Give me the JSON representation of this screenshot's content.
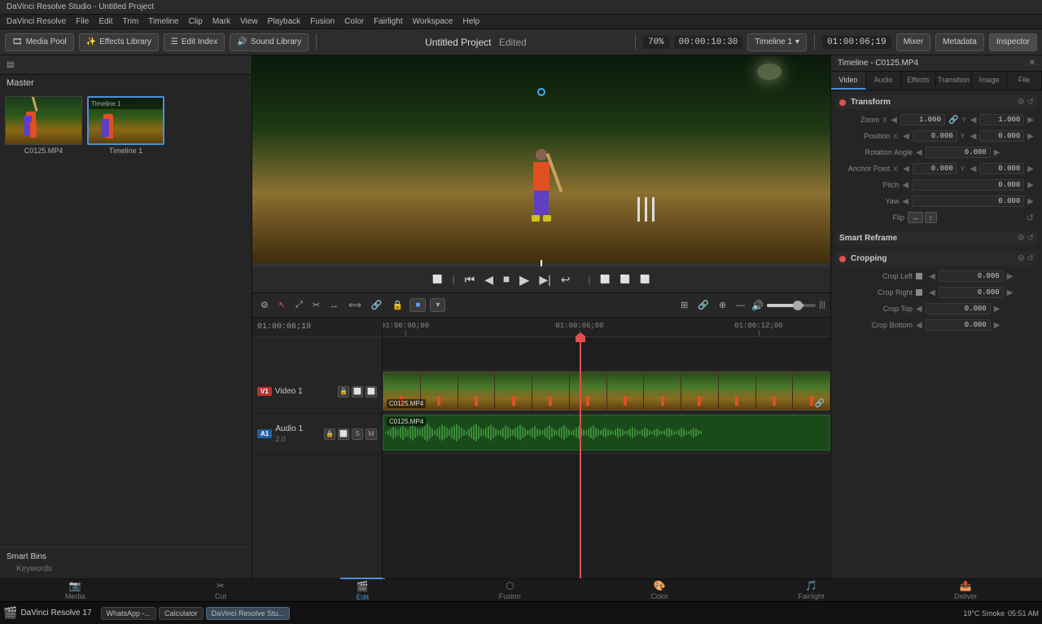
{
  "window": {
    "title": "DaVinci Resolve Studio - Untitled Project"
  },
  "menu": {
    "items": [
      "DaVinci Resolve",
      "File",
      "Edit",
      "Trim",
      "Timeline",
      "Clip",
      "Mark",
      "View",
      "Playback",
      "Fusion",
      "Color",
      "Fairlight",
      "Workspace",
      "Help"
    ]
  },
  "toolbar": {
    "media_pool": "Media Pool",
    "effects_library": "Effects Library",
    "edit_index": "Edit Index",
    "sound_library": "Sound Library",
    "project_title": "Untitled Project",
    "edited": "Edited",
    "zoom": "70%",
    "timecode": "00:00:10:30",
    "timeline_name": "Timeline 1",
    "playhead_tc": "01:00:06;19",
    "mixer": "Mixer",
    "metadata": "Metadata",
    "inspector": "Inspector"
  },
  "timeline_header": {
    "label": "Timeline - C0125.MP4"
  },
  "left_panel": {
    "master_label": "Master",
    "media_items": [
      {
        "name": "C0125.MP4",
        "type": "video"
      },
      {
        "name": "Timeline 1",
        "type": "timeline"
      }
    ],
    "smart_bins": "Smart Bins",
    "keywords": "Keywords"
  },
  "preview": {
    "timecode": "01:00:06;19"
  },
  "preview_controls": {
    "buttons": [
      "⏮",
      "◀",
      "⏹",
      "▶",
      "⏭",
      "↩"
    ]
  },
  "timeline": {
    "ruler_marks": [
      "01:00:00;00",
      "01:00:06;00",
      "01:00:12;00"
    ],
    "playhead_position": "01:00:06;19",
    "tracks": [
      {
        "type": "video",
        "badge": "V1",
        "name": "Video 1",
        "clips": [
          {
            "label": "C0125.MP4"
          }
        ]
      },
      {
        "type": "audio",
        "badge": "A1",
        "name": "Audio 1",
        "number": "2.0",
        "clips": [
          {
            "label": "C0125.MP4"
          }
        ]
      }
    ]
  },
  "inspector": {
    "title": "Timeline - C0125.MP4",
    "tabs": [
      "Video",
      "Audio",
      "Effects",
      "Transition",
      "Image",
      "File"
    ],
    "active_tab": "Video",
    "sections": {
      "transform": {
        "title": "Transform",
        "fields": {
          "zoom_x": "1.000",
          "zoom_y": "1.000",
          "position_x": "0.000",
          "position_y": "0.000",
          "rotation_angle": "0.000",
          "anchor_point_x": "0.000",
          "anchor_point_y": "0.000",
          "pitch": "0.000",
          "yaw": "0.000"
        }
      },
      "smart_reframe": {
        "title": "Smart Reframe"
      },
      "cropping": {
        "title": "Cropping",
        "fields": {
          "crop_left": "0.000",
          "crop_right": "0.000",
          "crop_top": "0.000",
          "crop_bottom": "0.000"
        }
      }
    }
  },
  "bottom_tabs": [
    {
      "label": "Media",
      "icon": "📷",
      "active": false
    },
    {
      "label": "Cut",
      "icon": "✂",
      "active": false
    },
    {
      "label": "Edit",
      "icon": "🎬",
      "active": true
    },
    {
      "label": "Fusion",
      "icon": "⬡",
      "active": false
    },
    {
      "label": "Color",
      "icon": "🎨",
      "active": false
    },
    {
      "label": "Fairlight",
      "icon": "🎵",
      "active": false
    },
    {
      "label": "Deliver",
      "icon": "📤",
      "active": false
    }
  ],
  "taskbar": {
    "app_name": "DaVinci Resolve 17",
    "items": [
      {
        "label": "WhatsApp -...",
        "active": false
      },
      {
        "label": "Calculator",
        "active": false
      },
      {
        "label": "DaVinci Resolve Stu...",
        "active": true
      }
    ],
    "time": "05:51 AM",
    "temp": "19°C Smoke"
  }
}
